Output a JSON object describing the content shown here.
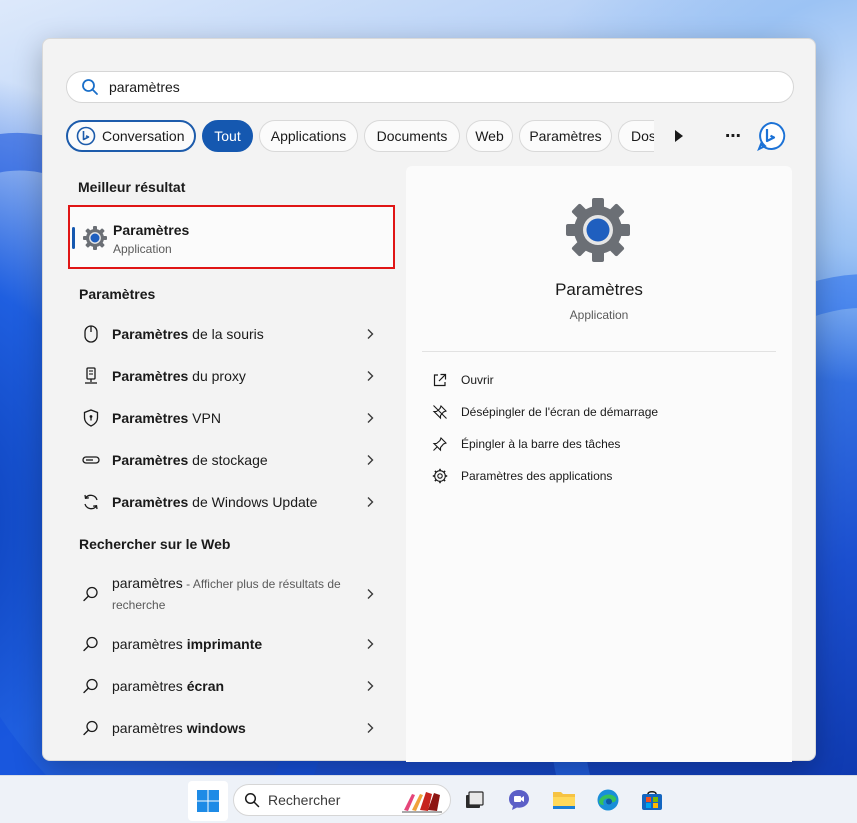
{
  "search": {
    "value": "paramètres"
  },
  "filters": {
    "conversation": "Conversation",
    "all": "Tout",
    "applications": "Applications",
    "documents": "Documents",
    "web": "Web",
    "settings": "Paramètres",
    "truncated": "Dos",
    "more_symbol": "⋯"
  },
  "best_match": {
    "heading": "Meilleur résultat",
    "name": "Paramètres",
    "type": "Application"
  },
  "settings_section": {
    "heading": "Paramètres",
    "items": [
      {
        "bold": "Paramètres",
        "rest": " de la souris",
        "icon": "mouse-icon"
      },
      {
        "bold": "Paramètres",
        "rest": " du proxy",
        "icon": "proxy-icon"
      },
      {
        "bold": "Paramètres",
        "rest": " VPN",
        "icon": "shield-icon"
      },
      {
        "bold": "Paramètres",
        "rest": " de stockage",
        "icon": "storage-icon"
      },
      {
        "bold": "Paramètres",
        "rest": " de Windows Update",
        "icon": "refresh-icon"
      }
    ]
  },
  "web_section": {
    "heading": "Rechercher sur le Web",
    "first": {
      "query": "paramètres",
      "hint_prefix": " - ",
      "hint": "Afficher plus de résultats de recherche"
    },
    "items": [
      {
        "normal": "paramètres ",
        "bold": "imprimante"
      },
      {
        "normal": "paramètres ",
        "bold": "écran"
      },
      {
        "normal": "paramètres ",
        "bold": "windows"
      }
    ]
  },
  "preview": {
    "title": "Paramètres",
    "subtitle": "Application",
    "actions": [
      {
        "label": "Ouvrir",
        "icon": "open-external-icon"
      },
      {
        "label": "Désépingler de l'écran de démarrage",
        "icon": "unpin-icon"
      },
      {
        "label": "Épingler à la barre des tâches",
        "icon": "pin-icon"
      },
      {
        "label": "Paramètres des applications",
        "icon": "gear-icon"
      }
    ]
  },
  "taskbar": {
    "search_label": "Rechercher",
    "apps": [
      "start-icon",
      "task-view-icon",
      "teams-chat-icon",
      "file-explorer-icon",
      "edge-icon",
      "store-icon"
    ]
  },
  "colors": {
    "accent": "#1558b0",
    "highlight_border": "#e01515",
    "panel_bg": "#f3f3f3"
  }
}
